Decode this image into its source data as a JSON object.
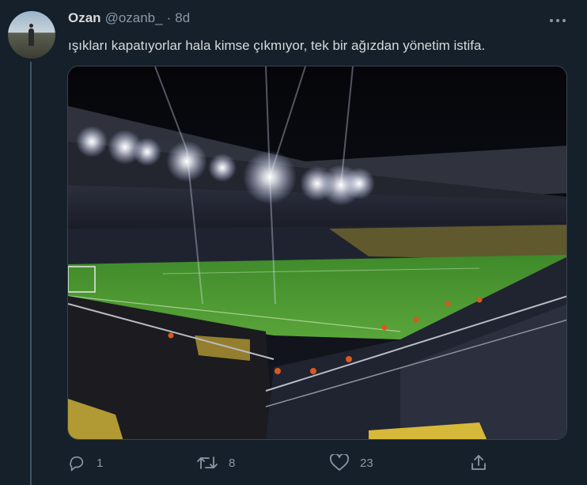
{
  "tweet": {
    "author_name": "Ozan",
    "author_handle": "@ozanb_",
    "separator": "·",
    "time": "8d",
    "text": "ışıkları kapatıyorlar hala kimse çıkmıyor, tek bir ağızdan yönetim istifa.",
    "image_alt": "Stadium at night with floodlights",
    "icons": {
      "more": "more-dots-icon",
      "reply": "reply-icon",
      "retweet": "retweet-icon",
      "like": "heart-icon",
      "share": "share-icon"
    },
    "stats": {
      "replies": "1",
      "retweets": "8",
      "likes": "23"
    }
  },
  "colors": {
    "background": "#15202b",
    "text": "#d9d9d9",
    "muted": "#8b98a5",
    "border": "#38444d"
  }
}
